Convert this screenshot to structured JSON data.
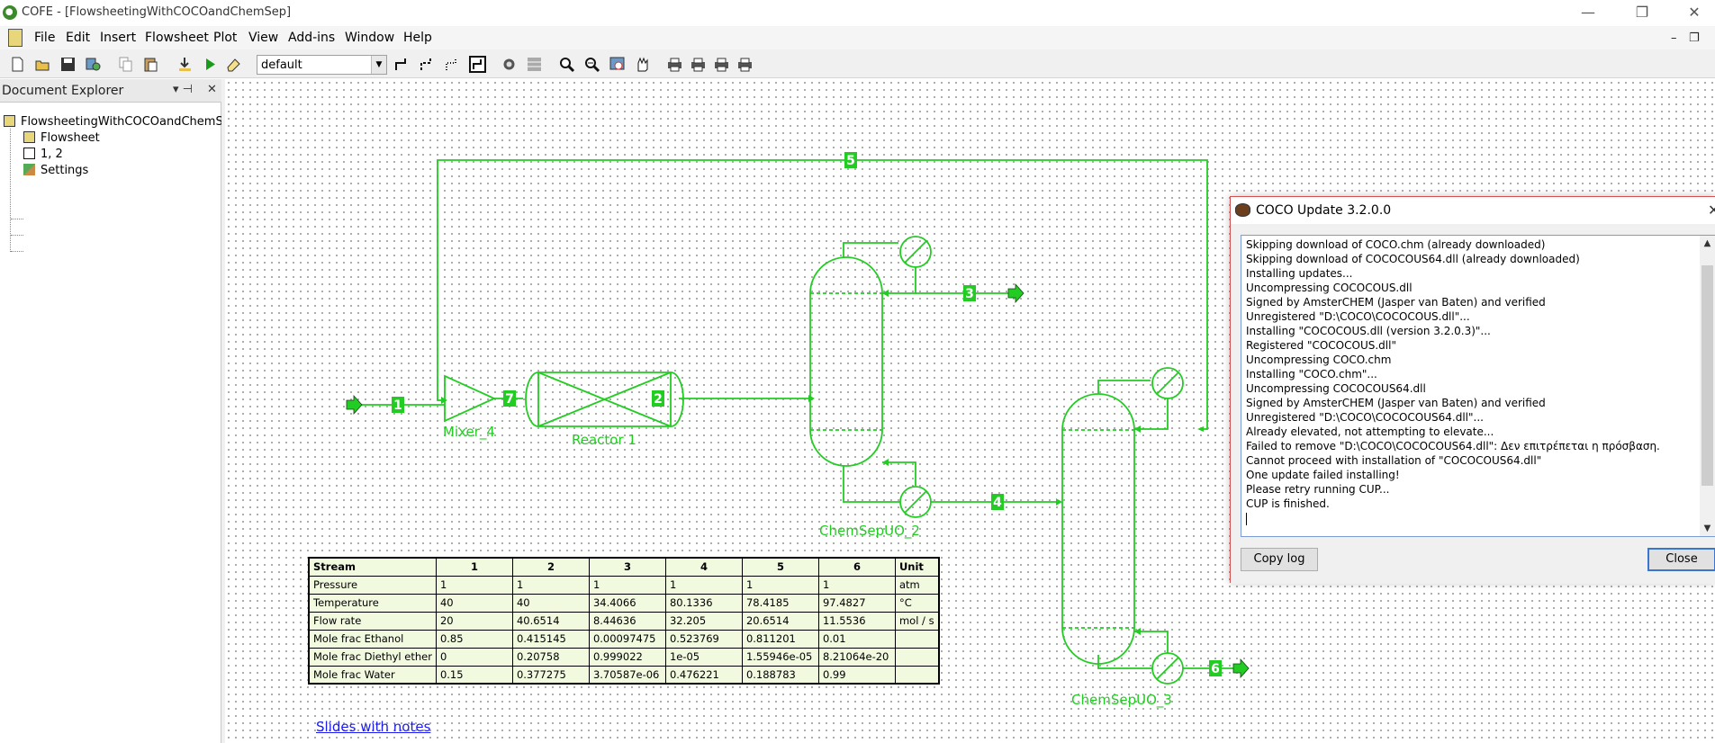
{
  "window": {
    "title": "COFE - [FlowsheetingWithCOCOandChemSep]",
    "minimize": "—",
    "restore": "❐",
    "close": "✕"
  },
  "menu": {
    "items": [
      "File",
      "Edit",
      "Insert",
      "Flowsheet",
      "Plot",
      "View",
      "Add-ins",
      "Window",
      "Help"
    ],
    "mdi_minimize": "–",
    "mdi_restore": "❐"
  },
  "toolbar": {
    "select_value": "default",
    "icons": [
      "new-icon",
      "open-icon",
      "save-icon",
      "properties-icon",
      "copy-icon",
      "paste-icon",
      "import-icon",
      "run-icon",
      "erase-icon",
      "stream-icon",
      "stream-energy-icon",
      "stream-info-icon",
      "stream-frame-icon",
      "unit-op-icon",
      "grid-icon",
      "zoom-in-icon",
      "zoom-out-icon",
      "zoom-fit-icon",
      "pan-hand-icon",
      "print-icon",
      "print-preview-icon",
      "print-setup-icon",
      "print-report-icon"
    ]
  },
  "explorer": {
    "title": "Document Explorer",
    "pin": "▾ ⊣",
    "close": "✕",
    "root": "FlowsheetingWithCOCOandChemSep",
    "items": [
      "Flowsheet",
      "1, 2",
      "Settings"
    ]
  },
  "flowsheet": {
    "units": {
      "mixer": "Mixer_4",
      "reactor": "Reactor 1",
      "column1": "ChemSepUO_2",
      "column2": "ChemSepUO_3"
    },
    "streams": [
      "1",
      "2",
      "3",
      "4",
      "5",
      "6",
      "7"
    ],
    "colors": {
      "stream": "#22cc22",
      "label_bg": "#22cc22",
      "label_text": "#ffffff"
    }
  },
  "table": {
    "header": [
      "Stream",
      "1",
      "2",
      "3",
      "4",
      "5",
      "6",
      "Unit"
    ],
    "rows": [
      [
        "Pressure",
        "1",
        "1",
        "1",
        "1",
        "1",
        "1",
        "atm"
      ],
      [
        "Temperature",
        "40",
        "40",
        "34.4066",
        "80.1336",
        "78.4185",
        "97.4827",
        "°C"
      ],
      [
        "Flow rate",
        "20",
        "40.6514",
        "8.44636",
        "32.205",
        "20.6514",
        "11.5536",
        "mol / s"
      ],
      [
        "Mole frac Ethanol",
        "0.85",
        "0.415145",
        "0.00097475",
        "0.523769",
        "0.811201",
        "0.01",
        ""
      ],
      [
        "Mole frac Diethyl ether",
        "0",
        "0.20758",
        "0.999022",
        "1e-05",
        "1.55946e-05",
        "8.21064e-20",
        ""
      ],
      [
        "Mole frac Water",
        "0.15",
        "0.377275",
        "3.70587e-06",
        "0.476221",
        "0.188783",
        "0.99",
        ""
      ]
    ]
  },
  "link": {
    "text": "Slides with notes"
  },
  "dialog": {
    "title": "COCO Update 3.2.0.0",
    "close_x": "✕",
    "log": [
      "Skipping download of COCO.chm (already downloaded)",
      "Skipping download of COCOCOUS64.dll (already downloaded)",
      "Installing updates...",
      "Uncompressing COCOCOUS.dll",
      "Signed by AmsterCHEM (Jasper van Baten) and verified",
      "Unregistered \"D:\\COCO\\COCOCOUS.dll\"...",
      "Installing \"COCOCOUS.dll (version 3.2.0.3)\"...",
      "Registered \"COCOCOUS.dll\"",
      "Uncompressing COCO.chm",
      "Installing \"COCO.chm\"...",
      "Uncompressing COCOCOUS64.dll",
      "Signed by AmsterCHEM (Jasper van Baten) and verified",
      "Unregistered \"D:\\COCO\\COCOCOUS64.dll\"...",
      "Already elevated, not attempting to elevate...",
      "Failed to remove \"D:\\COCO\\COCOCOUS64.dll\": Δεν επιτρέπεται η πρόσβαση.",
      "Cannot proceed with installation of \"COCOCOUS64.dll\"",
      "One update failed installing!",
      "Please retry running CUP...",
      "CUP is finished."
    ],
    "copy_log": "Copy log",
    "close": "Close"
  }
}
